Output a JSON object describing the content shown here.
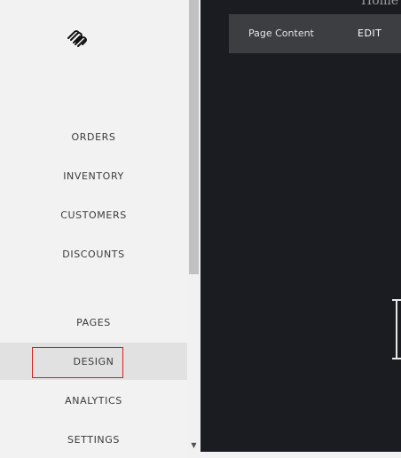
{
  "sidebar": {
    "logo_icon": "squarespace-logo-icon",
    "items": [
      {
        "label": "ORDERS"
      },
      {
        "label": "INVENTORY"
      },
      {
        "label": "CUSTOMERS"
      },
      {
        "label": "DISCOUNTS"
      },
      {
        "label": "PAGES"
      },
      {
        "label": "DESIGN",
        "active": true
      },
      {
        "label": "ANALYTICS"
      },
      {
        "label": "SETTINGS"
      }
    ],
    "highlight_color": "#d61f1f"
  },
  "preview": {
    "home_link": "Home",
    "page_content_label": "Page Content",
    "edit_label": "EDIT",
    "background": "#1b1c21"
  }
}
